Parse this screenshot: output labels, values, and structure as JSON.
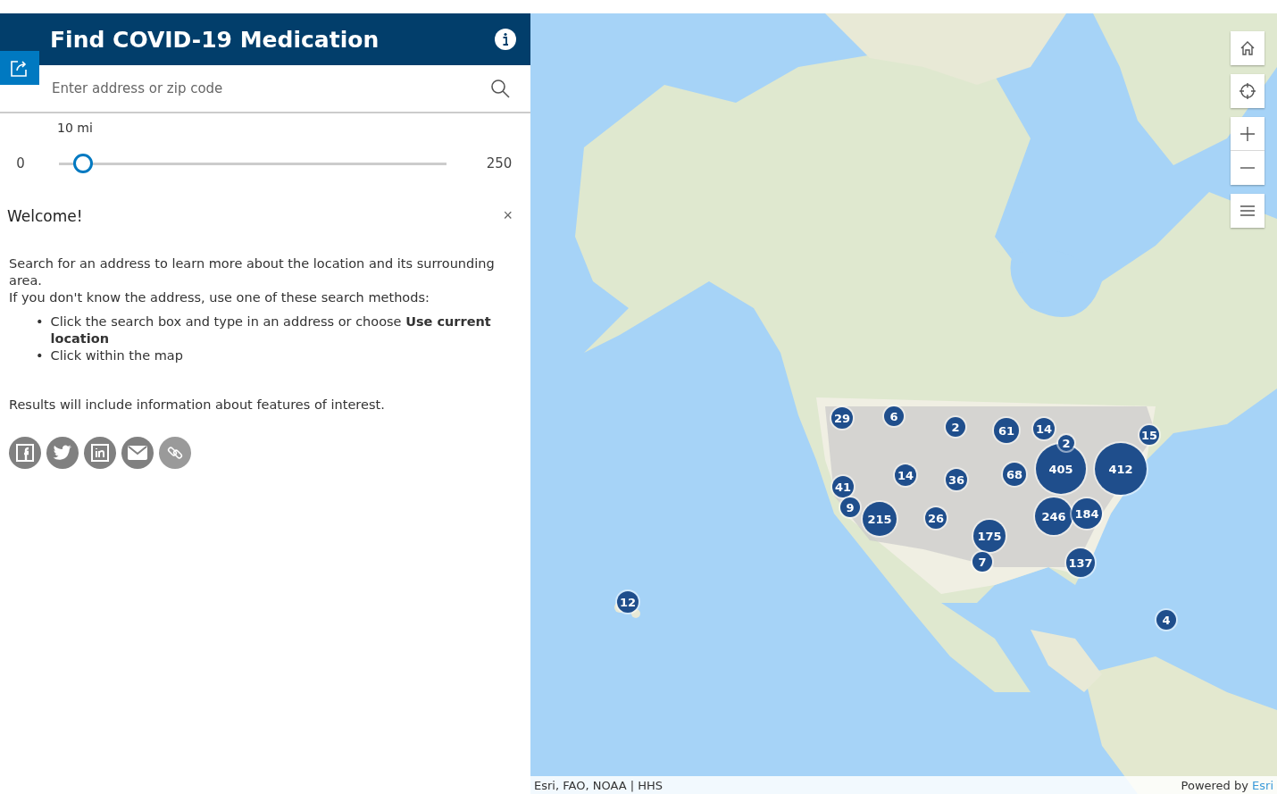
{
  "header": {
    "title": "Find COVID-19 Medication"
  },
  "search": {
    "placeholder": "Enter address or zip code"
  },
  "distance": {
    "value_label": "10 mi",
    "min": "0",
    "max": "250",
    "level": 0.04
  },
  "welcome": {
    "title": "Welcome!",
    "close": "×",
    "intro": [
      "Search for an address to learn more about the location and its surrounding area.",
      "If you don't know the address, use one of these search methods:"
    ],
    "bullets": [
      {
        "marker": "•",
        "text": "Click the search box and type in an address or choose **Use current location**"
      },
      {
        "marker": "•",
        "text": "Click within the map"
      }
    ],
    "results": "Results will include information about features of interest."
  },
  "share": [
    {
      "kind": "facebook"
    },
    {
      "kind": "twitter"
    },
    {
      "kind": "linkedin"
    },
    {
      "kind": "email"
    },
    {
      "kind": "link"
    }
  ],
  "map": {
    "clusters": [
      {
        "count": "29"
      },
      {
        "count": "6"
      },
      {
        "count": "2"
      },
      {
        "count": "61"
      },
      {
        "count": "14"
      },
      {
        "count": "2"
      },
      {
        "count": "15"
      },
      {
        "count": "405"
      },
      {
        "count": "412"
      },
      {
        "count": "14"
      },
      {
        "count": "36"
      },
      {
        "count": "68"
      },
      {
        "count": "41"
      },
      {
        "count": "9"
      },
      {
        "count": "215"
      },
      {
        "count": "26"
      },
      {
        "count": "175"
      },
      {
        "count": "246"
      },
      {
        "count": "184"
      },
      {
        "count": "7"
      },
      {
        "count": "137"
      },
      {
        "count": "12"
      },
      {
        "count": "4"
      }
    ],
    "controls": [
      {
        "kind": "home"
      },
      {
        "kind": "locate"
      },
      {
        "kind": "zoom-in"
      },
      {
        "kind": "zoom-out"
      },
      {
        "kind": "legend"
      }
    ],
    "attribution": "Esri, FAO, NOAA | HHS",
    "powered_prefix": "Powered by ",
    "powered_link": "Esri"
  }
}
